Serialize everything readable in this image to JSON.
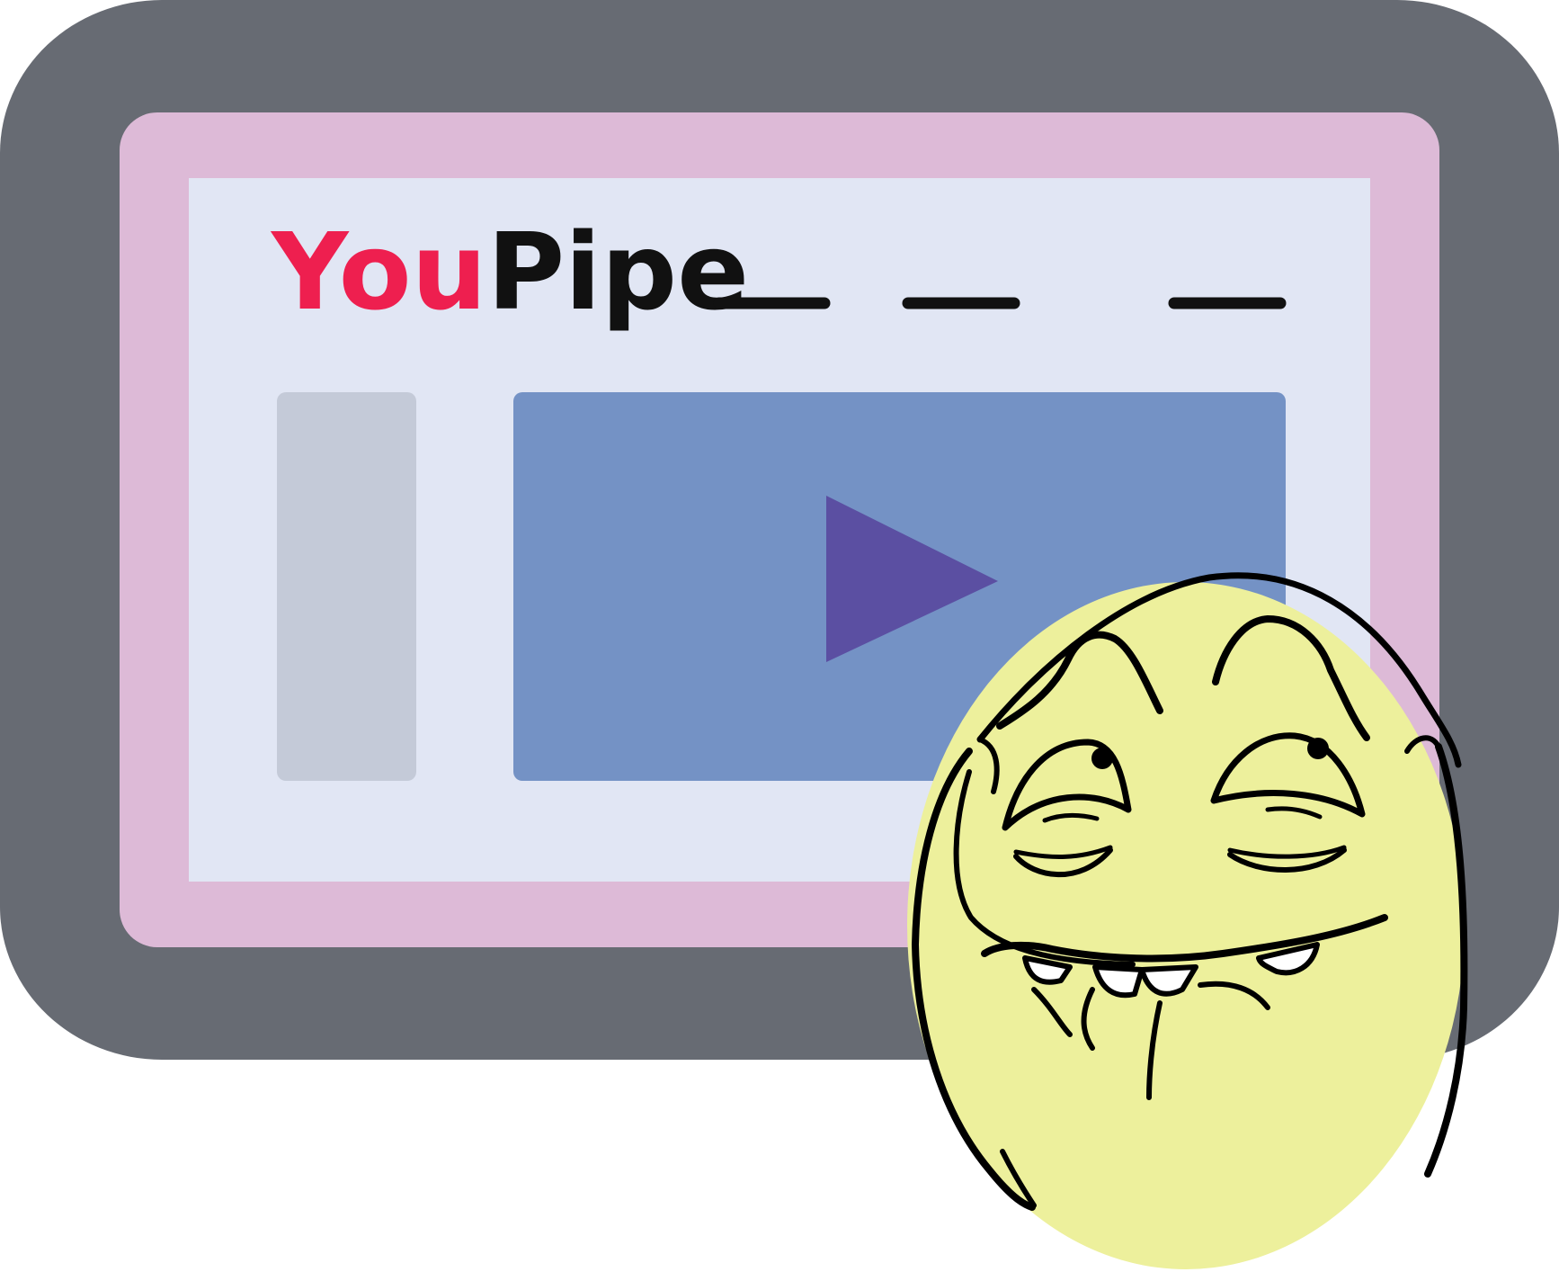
{
  "logo": {
    "part1": "You",
    "part2": "Pipe"
  },
  "colors": {
    "frame_outer": "#676b73",
    "frame_inner": "#ddbad7",
    "screen": "#e1e6f4",
    "sidebar": "#c4cad8",
    "video": "#7492c5",
    "play": "#5b4fa2",
    "logo_red": "#ee1f4f",
    "logo_black": "#111111",
    "face": "#edf09c",
    "ink": "#000000"
  },
  "icons": {
    "play": "play-triangle-icon",
    "face": "trollface-meme-icon",
    "nav": "placeholder-line-icon"
  }
}
